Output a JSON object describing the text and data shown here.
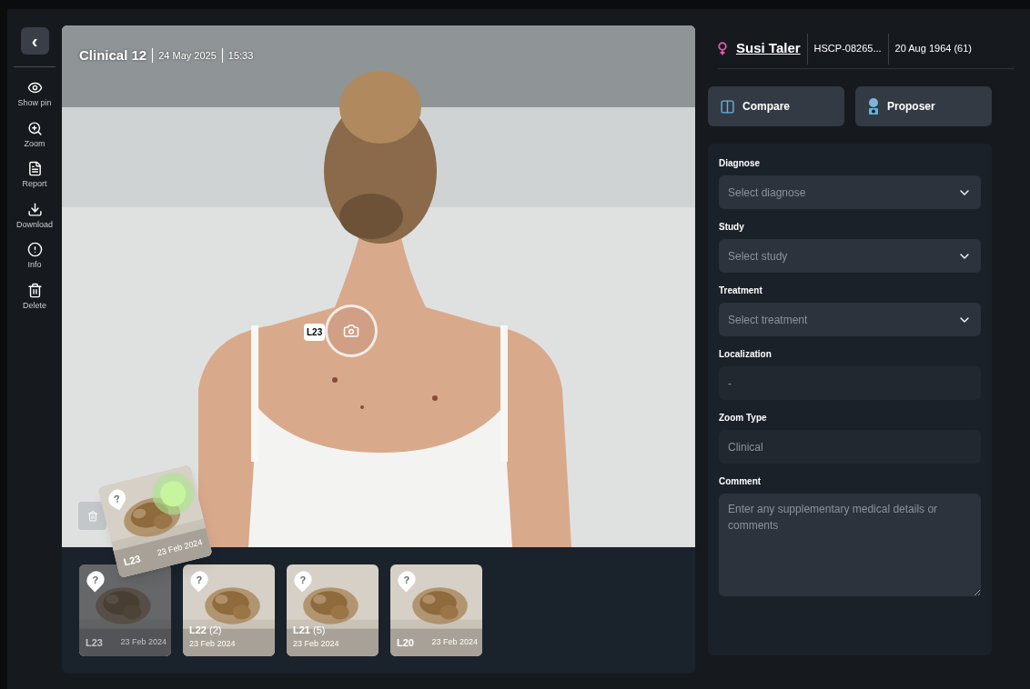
{
  "sidebar": {
    "back_button": "‹",
    "items": [
      {
        "label": "Show pin"
      },
      {
        "label": "Zoom"
      },
      {
        "label": "Report"
      },
      {
        "label": "Download"
      },
      {
        "label": "Info"
      },
      {
        "label": "Delete"
      }
    ]
  },
  "image": {
    "title": "Clinical 12",
    "date": "24 May 2025",
    "time": "15:33",
    "pin": {
      "label": "L23"
    }
  },
  "dragged_card": {
    "label": "L23",
    "date": "23 Feb 2024",
    "badge": "?"
  },
  "thumbnails": [
    {
      "label": "L23",
      "date": "23 Feb 2024",
      "badge": "?",
      "dimmed": true
    },
    {
      "label": "L22",
      "count": "(2)",
      "date": "23 Feb 2024",
      "badge": "?",
      "dimmed": false
    },
    {
      "label": "L21",
      "count": "(5)",
      "date": "23 Feb 2024",
      "badge": "?",
      "dimmed": false
    },
    {
      "label": "L20",
      "date": "23 Feb 2024",
      "badge": "?",
      "dimmed": false
    }
  ],
  "patient": {
    "name": "Susi Taler",
    "id": "HSCP-08265...",
    "birth": "20 Aug 1964 (61)"
  },
  "actions": [
    {
      "label": "Compare"
    },
    {
      "label": "Proposer"
    }
  ],
  "form": [
    {
      "kind": "select",
      "label": "Diagnose",
      "placeholder": "Select diagnose"
    },
    {
      "kind": "select",
      "label": "Study",
      "placeholder": "Select study"
    },
    {
      "kind": "select",
      "label": "Treatment",
      "placeholder": "Select treatment"
    },
    {
      "kind": "readonly",
      "label": "Localization",
      "value": "-"
    },
    {
      "kind": "readonly",
      "label": "Zoom Type",
      "value": "Clinical"
    },
    {
      "kind": "textarea",
      "label": "Comment",
      "placeholder": "Enter any supplementary medical details or comments"
    }
  ]
}
